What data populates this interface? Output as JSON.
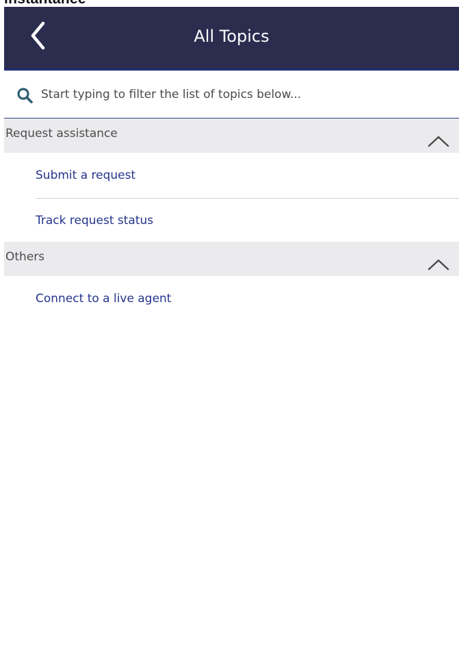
{
  "top_banner": {
    "text": "instantanée"
  },
  "header": {
    "title": "All Topics",
    "back_icon": "chevron-left-icon"
  },
  "search": {
    "placeholder": "Start typing to filter the list of topics below...",
    "value": "",
    "icon": "search-icon"
  },
  "sections": [
    {
      "title": "Request assistance",
      "expanded": true,
      "items": [
        {
          "label": "Submit a request"
        },
        {
          "label": "Track request status"
        }
      ]
    },
    {
      "title": "Others",
      "expanded": true,
      "items": [
        {
          "label": "Connect to a live agent"
        }
      ]
    }
  ],
  "colors": {
    "header_bg": "#2b2d4f",
    "accent": "#23348c",
    "section_bg": "#ebebee",
    "section_text": "#4d4d4d"
  }
}
